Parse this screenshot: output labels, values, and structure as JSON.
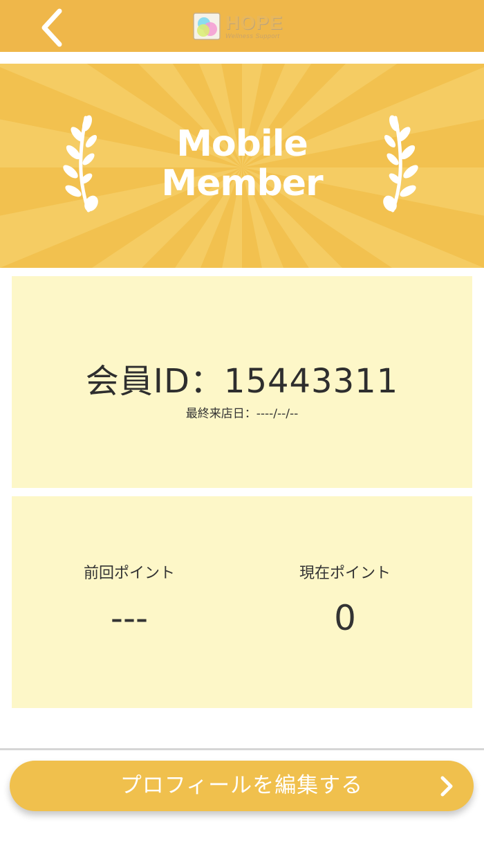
{
  "header": {
    "logo": {
      "title": "HOPE",
      "subtitle": "Wellness Support"
    },
    "icons": {
      "back": "chevron-left-icon"
    }
  },
  "banner": {
    "title_line1": "Mobile",
    "title_line2": "Member"
  },
  "member": {
    "id_label": "会員ID：15443311",
    "last_visit": "最終来店日：----/--/--"
  },
  "points": {
    "previous_label": "前回ポイント",
    "previous_value": "---",
    "current_label": "現在ポイント",
    "current_value": "0"
  },
  "actions": {
    "edit_profile_label": "プロフィールを編集する",
    "edit_profile_icon": "chevron-right-icon"
  },
  "colors": {
    "header": "#efb74a",
    "banner": "#f2c14f",
    "card": "#fdf7c8",
    "button": "#f0c04d"
  }
}
